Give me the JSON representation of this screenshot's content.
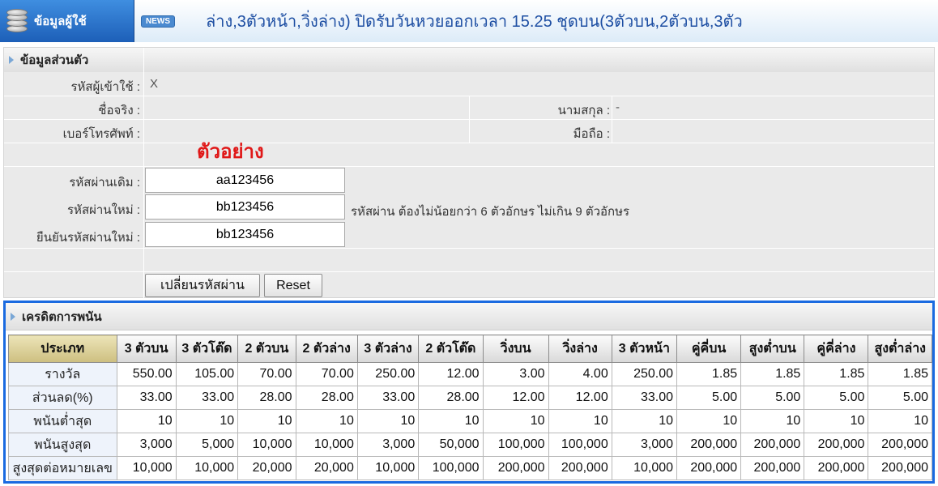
{
  "header": {
    "brand": "ข้อมูลผู้ใช้",
    "news_badge": "NEWS",
    "marquee": "ล่าง,3ตัวหน้า,วิ่งล่าง) ปิดรับวันหวยออกเวลา 15.25 ชุดบน(3ตัวบน,2ตัวบน,3ตัว"
  },
  "profile": {
    "title": "ข้อมูลส่วนตัว",
    "username_label": "รหัสผู้เข้าใช้ :",
    "username_value": "X",
    "firstname_label": "ชื่อจริง :",
    "lastname_label": "นามสกุล :",
    "lastname_value": "-",
    "phone_label": "เบอร์โทรศัพท์ :",
    "mobile_label": "มือถือ :",
    "sample_text": "ตัวอย่าง",
    "old_pwd_label": "รหัสผ่านเดิม :",
    "old_pwd_value": "aa123456",
    "new_pwd_label": "รหัสผ่านใหม่ :",
    "new_pwd_value": "bb123456",
    "pwd_hint": "รหัสผ่าน ต้องไม่น้อยกว่า 6 ตัวอักษร ไม่เกิน 9 ตัวอักษร",
    "confirm_pwd_label": "ยืนยันรหัสผ่านใหม่ :",
    "confirm_pwd_value": "bb123456",
    "change_button": "เปลี่ยนรหัสผ่าน",
    "reset_button": "Reset"
  },
  "credit": {
    "title": "เครดิตการพนัน",
    "headers": [
      "ประเภท",
      "3 ตัวบน",
      "3 ตัวโต๊ด",
      "2 ตัวบน",
      "2 ตัวล่าง",
      "3 ตัวล่าง",
      "2 ตัวโต๊ด",
      "วิ่งบน",
      "วิ่งล่าง",
      "3 ตัวหน้า",
      "คู่คี่บน",
      "สูงต่ำบน",
      "คู่คี่ล่าง",
      "สูงต่ำล่าง"
    ],
    "rows": [
      [
        "รางวัล",
        "550.00",
        "105.00",
        "70.00",
        "70.00",
        "250.00",
        "12.00",
        "3.00",
        "4.00",
        "250.00",
        "1.85",
        "1.85",
        "1.85",
        "1.85"
      ],
      [
        "ส่วนลด(%)",
        "33.00",
        "33.00",
        "28.00",
        "28.00",
        "33.00",
        "28.00",
        "12.00",
        "12.00",
        "33.00",
        "5.00",
        "5.00",
        "5.00",
        "5.00"
      ],
      [
        "พนันต่ำสุด",
        "10",
        "10",
        "10",
        "10",
        "10",
        "10",
        "10",
        "10",
        "10",
        "10",
        "10",
        "10",
        "10"
      ],
      [
        "พนันสูงสุด",
        "3,000",
        "5,000",
        "10,000",
        "10,000",
        "3,000",
        "50,000",
        "100,000",
        "100,000",
        "3,000",
        "200,000",
        "200,000",
        "200,000",
        "200,000"
      ],
      [
        "สูงสุดต่อหมายเลข",
        "10,000",
        "10,000",
        "20,000",
        "20,000",
        "10,000",
        "100,000",
        "200,000",
        "200,000",
        "10,000",
        "200,000",
        "200,000",
        "200,000",
        "200,000"
      ]
    ]
  }
}
